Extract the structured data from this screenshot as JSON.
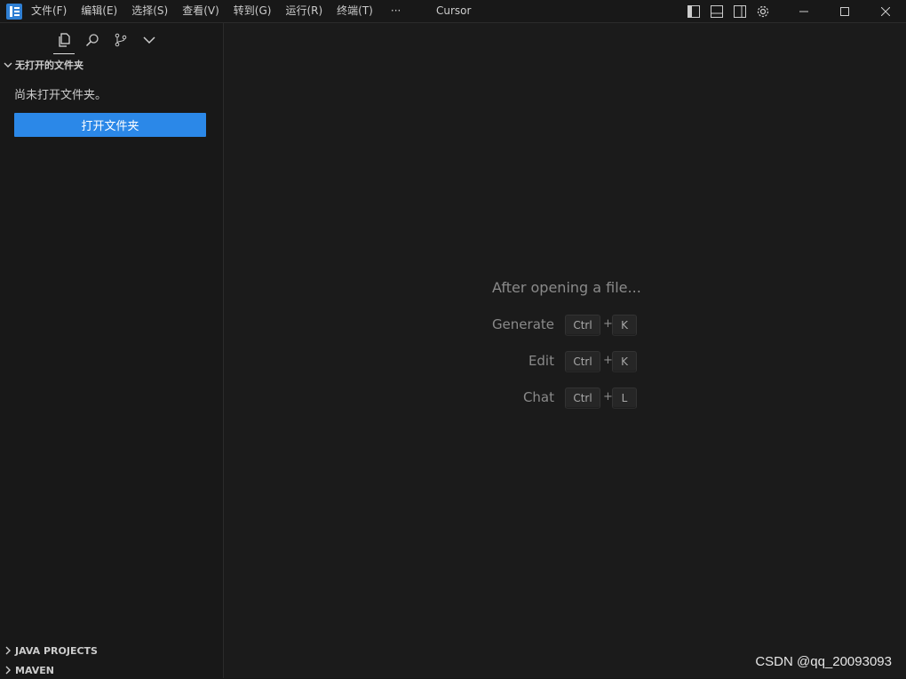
{
  "app": {
    "logo_icon": "cursor-app-icon"
  },
  "menu": [
    "文件(F)",
    "编辑(E)",
    "选择(S)",
    "查看(V)",
    "转到(G)",
    "运行(R)",
    "终端(T)",
    "···"
  ],
  "window_title": "Cursor",
  "titlebar_icons": [
    "toggle-primary-sidebar-icon",
    "toggle-panel-icon",
    "toggle-secondary-sidebar-icon",
    "settings-gear-icon"
  ],
  "window_controls": [
    "minimize-icon",
    "maximize-icon",
    "close-icon"
  ],
  "activity_tabs": [
    {
      "name": "explorer-icon",
      "active": true
    },
    {
      "name": "search-icon",
      "active": false
    },
    {
      "name": "source-control-icon",
      "active": false
    },
    {
      "name": "more-chevron-icon",
      "active": false
    }
  ],
  "sidebar": {
    "section_title": "无打开的文件夹",
    "empty_message": "尚未打开文件夹。",
    "open_folder_button": "打开文件夹",
    "bottom_sections": [
      "JAVA PROJECTS",
      "MAVEN"
    ]
  },
  "editor": {
    "hint_title": "After opening a file...",
    "shortcuts": [
      {
        "label": "Generate",
        "keys": [
          "Ctrl",
          "K"
        ]
      },
      {
        "label": "Edit",
        "keys": [
          "Ctrl",
          "K"
        ]
      },
      {
        "label": "Chat",
        "keys": [
          "Ctrl",
          "L"
        ]
      }
    ],
    "plus": "+"
  },
  "watermark": "CSDN @qq_20093093",
  "colors": {
    "background": "#181818",
    "accent_button": "#2b88e8",
    "logo": "#2f7fd3"
  }
}
